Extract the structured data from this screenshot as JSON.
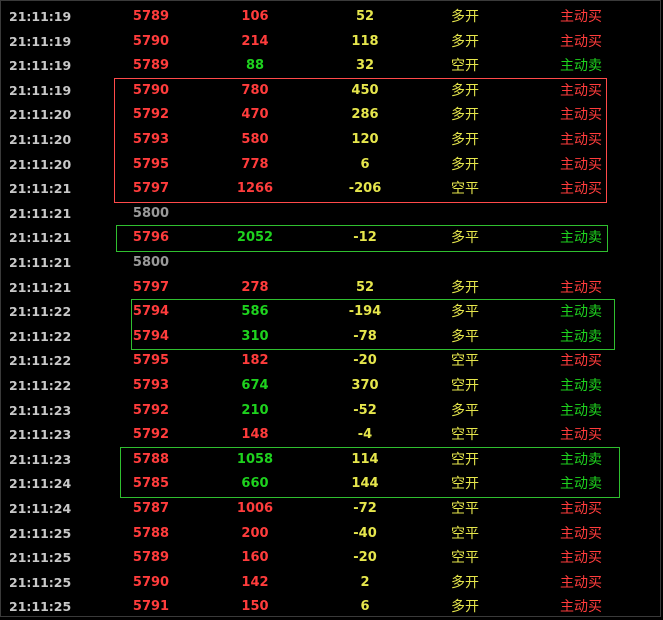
{
  "colors": {
    "up": "#ff3c3c",
    "down": "#1ed21e",
    "neutral": "#9a9a9a",
    "change": "#e6e64c",
    "time": "#c8c8c8"
  },
  "rows": [
    {
      "time": "21:11:19",
      "price": "5789",
      "vol": "106",
      "chg": "52",
      "kind": "多开",
      "dir": "主动买",
      "pc": "red",
      "vc": "red",
      "dc": "red"
    },
    {
      "time": "21:11:19",
      "price": "5790",
      "vol": "214",
      "chg": "118",
      "kind": "多开",
      "dir": "主动买",
      "pc": "red",
      "vc": "red",
      "dc": "red"
    },
    {
      "time": "21:11:19",
      "price": "5789",
      "vol": "88",
      "chg": "32",
      "kind": "空开",
      "dir": "主动卖",
      "pc": "red",
      "vc": "green",
      "dc": "green"
    },
    {
      "time": "21:11:19",
      "price": "5790",
      "vol": "780",
      "chg": "450",
      "kind": "多开",
      "dir": "主动买",
      "pc": "red",
      "vc": "red",
      "dc": "red"
    },
    {
      "time": "21:11:20",
      "price": "5792",
      "vol": "470",
      "chg": "286",
      "kind": "多开",
      "dir": "主动买",
      "pc": "red",
      "vc": "red",
      "dc": "red"
    },
    {
      "time": "21:11:20",
      "price": "5793",
      "vol": "580",
      "chg": "120",
      "kind": "多开",
      "dir": "主动买",
      "pc": "red",
      "vc": "red",
      "dc": "red"
    },
    {
      "time": "21:11:20",
      "price": "5795",
      "vol": "778",
      "chg": "6",
      "kind": "多开",
      "dir": "主动买",
      "pc": "red",
      "vc": "red",
      "dc": "red"
    },
    {
      "time": "21:11:21",
      "price": "5797",
      "vol": "1266",
      "chg": "-206",
      "kind": "空平",
      "dir": "主动买",
      "pc": "red",
      "vc": "red",
      "dc": "red"
    },
    {
      "time": "21:11:21",
      "price": "5800",
      "vol": "",
      "chg": "",
      "kind": "",
      "dir": "",
      "pc": "gray",
      "vc": "red",
      "dc": "red"
    },
    {
      "time": "21:11:21",
      "price": "5796",
      "vol": "2052",
      "chg": "-12",
      "kind": "多平",
      "dir": "主动卖",
      "pc": "red",
      "vc": "green",
      "dc": "green"
    },
    {
      "time": "21:11:21",
      "price": "5800",
      "vol": "",
      "chg": "",
      "kind": "",
      "dir": "",
      "pc": "gray",
      "vc": "red",
      "dc": "red"
    },
    {
      "time": "21:11:21",
      "price": "5797",
      "vol": "278",
      "chg": "52",
      "kind": "多开",
      "dir": "主动买",
      "pc": "red",
      "vc": "red",
      "dc": "red"
    },
    {
      "time": "21:11:22",
      "price": "5794",
      "vol": "586",
      "chg": "-194",
      "kind": "多平",
      "dir": "主动卖",
      "pc": "red",
      "vc": "green",
      "dc": "green"
    },
    {
      "time": "21:11:22",
      "price": "5794",
      "vol": "310",
      "chg": "-78",
      "kind": "多平",
      "dir": "主动卖",
      "pc": "red",
      "vc": "green",
      "dc": "green"
    },
    {
      "time": "21:11:22",
      "price": "5795",
      "vol": "182",
      "chg": "-20",
      "kind": "空平",
      "dir": "主动买",
      "pc": "red",
      "vc": "red",
      "dc": "red"
    },
    {
      "time": "21:11:22",
      "price": "5793",
      "vol": "674",
      "chg": "370",
      "kind": "空开",
      "dir": "主动卖",
      "pc": "red",
      "vc": "green",
      "dc": "green"
    },
    {
      "time": "21:11:23",
      "price": "5792",
      "vol": "210",
      "chg": "-52",
      "kind": "多平",
      "dir": "主动卖",
      "pc": "red",
      "vc": "green",
      "dc": "green"
    },
    {
      "time": "21:11:23",
      "price": "5792",
      "vol": "148",
      "chg": "-4",
      "kind": "空平",
      "dir": "主动买",
      "pc": "red",
      "vc": "red",
      "dc": "red"
    },
    {
      "time": "21:11:23",
      "price": "5788",
      "vol": "1058",
      "chg": "114",
      "kind": "空开",
      "dir": "主动卖",
      "pc": "red",
      "vc": "green",
      "dc": "green"
    },
    {
      "time": "21:11:24",
      "price": "5785",
      "vol": "660",
      "chg": "144",
      "kind": "空开",
      "dir": "主动卖",
      "pc": "red",
      "vc": "green",
      "dc": "green"
    },
    {
      "time": "21:11:24",
      "price": "5787",
      "vol": "1006",
      "chg": "-72",
      "kind": "空平",
      "dir": "主动买",
      "pc": "red",
      "vc": "red",
      "dc": "red"
    },
    {
      "time": "21:11:25",
      "price": "5788",
      "vol": "200",
      "chg": "-40",
      "kind": "空平",
      "dir": "主动买",
      "pc": "red",
      "vc": "red",
      "dc": "red"
    },
    {
      "time": "21:11:25",
      "price": "5789",
      "vol": "160",
      "chg": "-20",
      "kind": "空平",
      "dir": "主动买",
      "pc": "red",
      "vc": "red",
      "dc": "red"
    },
    {
      "time": "21:11:25",
      "price": "5790",
      "vol": "142",
      "chg": "2",
      "kind": "多开",
      "dir": "主动买",
      "pc": "red",
      "vc": "red",
      "dc": "red"
    },
    {
      "time": "21:11:25",
      "price": "5791",
      "vol": "150",
      "chg": "6",
      "kind": "多开",
      "dir": "主动买",
      "pc": "red",
      "vc": "red",
      "dc": "red"
    }
  ],
  "highlights": [
    {
      "color": "red",
      "first": 3,
      "last": 7
    },
    {
      "color": "green",
      "first": 9,
      "last": 9
    },
    {
      "color": "green",
      "first": 12,
      "last": 13
    },
    {
      "color": "green",
      "first": 18,
      "last": 19
    }
  ]
}
